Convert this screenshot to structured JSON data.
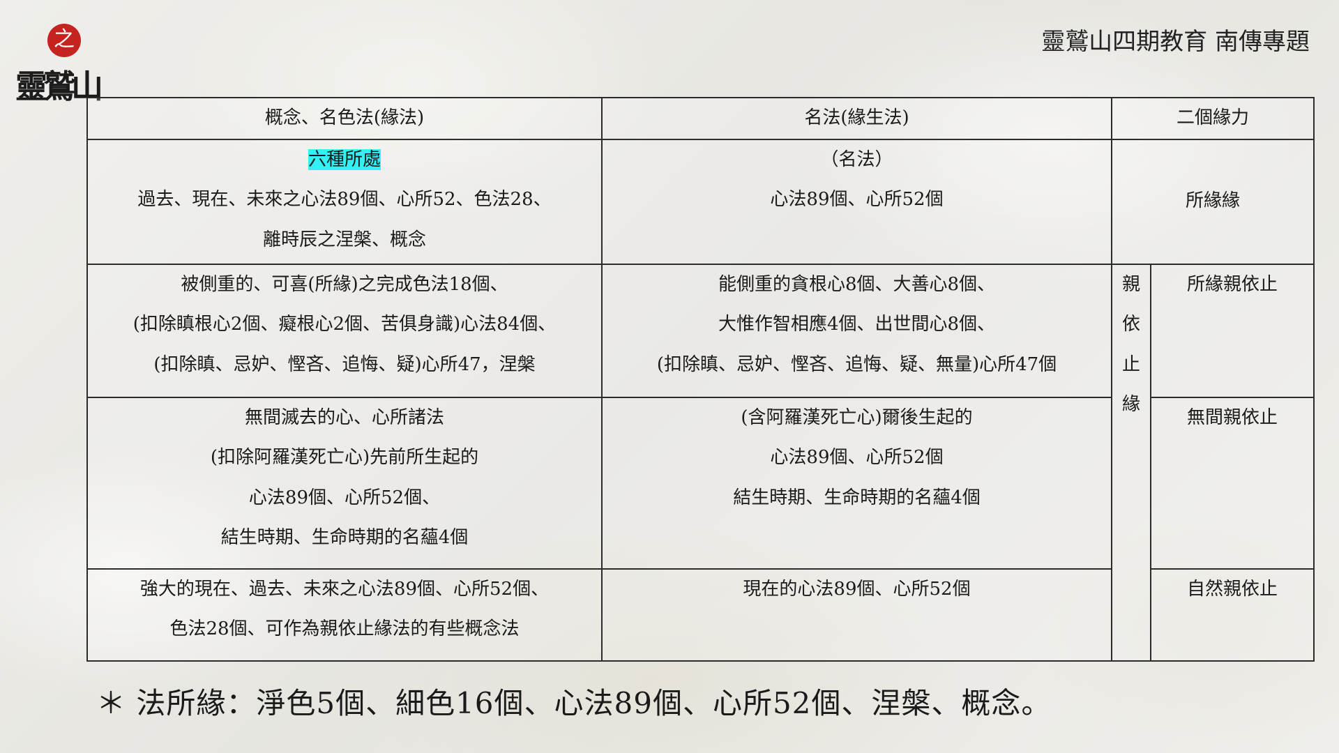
{
  "logo": {
    "seal_char": "之",
    "text": "靈鷲山"
  },
  "header": {
    "brand": "靈鷲山四期教育 南傳專題"
  },
  "table": {
    "headers": [
      "概念、名色法(緣法)",
      "名法(緣生法)",
      "二個緣力"
    ],
    "row1": {
      "c1_highlight": "六種所處",
      "c1": [
        "過去、現在、未來之心法89個、心所52、色法28、",
        "離時辰之涅槃、概念"
      ],
      "c2": [
        "（名法）",
        "心法89個、心所52個"
      ],
      "c3": "所緣緣"
    },
    "row2": {
      "c1": [
        "被側重的、可喜(所緣)之完成色法18個、",
        "(扣除瞋根心2個、癡根心2個、苦俱身識)心法84個、",
        "(扣除瞋、忌妒、慳吝、追悔、疑)心所47，涅槃"
      ],
      "c2": [
        "能側重的貪根心8個、大善心8個、",
        "大惟作智相應4個、出世間心8個、",
        "(扣除瞋、忌妒、慳吝、追悔、疑、無量)心所47個"
      ],
      "vertical": [
        "親",
        "依",
        "止",
        "緣"
      ],
      "c3": "所緣親依止"
    },
    "row3": {
      "c1": [
        "無間滅去的心、心所諸法",
        "(扣除阿羅漢死亡心)先前所生起的",
        "心法89個、心所52個、",
        "結生時期、生命時期的名蘊4個"
      ],
      "c2": [
        "(含阿羅漢死亡心)爾後生起的",
        "心法89個、心所52個",
        "結生時期、生命時期的名蘊4個"
      ],
      "c3": "無間親依止"
    },
    "row4": {
      "c1": [
        "強大的現在、過去、未來之心法89個、心所52個、",
        "色法28個、可作為親依止緣法的有些概念法"
      ],
      "c2": [
        "現在的心法89個、心所52個"
      ],
      "c3": "自然親依止"
    }
  },
  "note": "＊ 法所緣：淨色5個、細色16個、心法89個、心所52個、涅槃、概念。",
  "colors": {
    "highlight": "#33f0f5",
    "seal": "#c4231f"
  }
}
